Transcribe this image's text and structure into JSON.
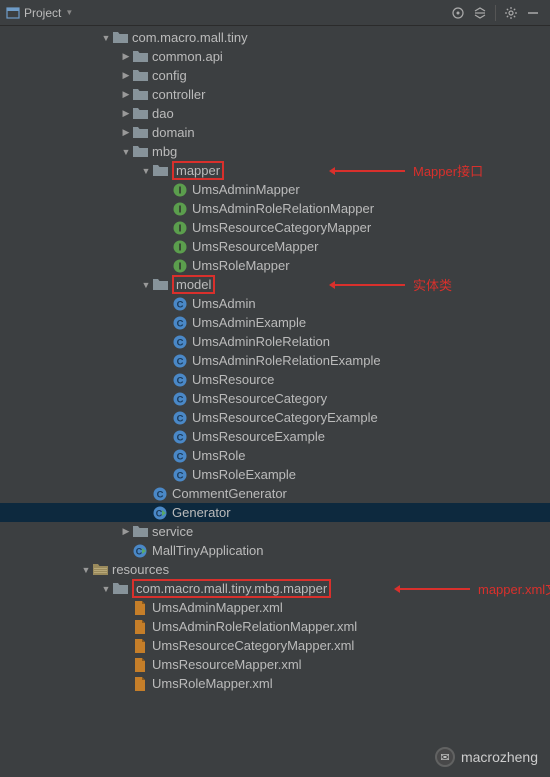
{
  "header": {
    "title": "Project"
  },
  "tree": [
    {
      "depth": 5,
      "arrow": "down",
      "icon": "folder",
      "label": "com.macro.mall.tiny"
    },
    {
      "depth": 6,
      "arrow": "right",
      "icon": "folder",
      "label": "common.api"
    },
    {
      "depth": 6,
      "arrow": "right",
      "icon": "folder",
      "label": "config"
    },
    {
      "depth": 6,
      "arrow": "right",
      "icon": "folder",
      "label": "controller"
    },
    {
      "depth": 6,
      "arrow": "right",
      "icon": "folder",
      "label": "dao"
    },
    {
      "depth": 6,
      "arrow": "right",
      "icon": "folder",
      "label": "domain"
    },
    {
      "depth": 6,
      "arrow": "down",
      "icon": "folder",
      "label": "mbg"
    },
    {
      "depth": 7,
      "arrow": "down",
      "icon": "folder",
      "label": "mapper",
      "boxed": true,
      "anno": "Mapper接口",
      "annoX": 335
    },
    {
      "depth": 8,
      "arrow": "",
      "icon": "interface",
      "label": "UmsAdminMapper"
    },
    {
      "depth": 8,
      "arrow": "",
      "icon": "interface",
      "label": "UmsAdminRoleRelationMapper"
    },
    {
      "depth": 8,
      "arrow": "",
      "icon": "interface",
      "label": "UmsResourceCategoryMapper"
    },
    {
      "depth": 8,
      "arrow": "",
      "icon": "interface",
      "label": "UmsResourceMapper"
    },
    {
      "depth": 8,
      "arrow": "",
      "icon": "interface",
      "label": "UmsRoleMapper"
    },
    {
      "depth": 7,
      "arrow": "down",
      "icon": "folder",
      "label": "model",
      "boxed": true,
      "anno": "实体类",
      "annoX": 335
    },
    {
      "depth": 8,
      "arrow": "",
      "icon": "class",
      "label": "UmsAdmin"
    },
    {
      "depth": 8,
      "arrow": "",
      "icon": "class",
      "label": "UmsAdminExample"
    },
    {
      "depth": 8,
      "arrow": "",
      "icon": "class",
      "label": "UmsAdminRoleRelation"
    },
    {
      "depth": 8,
      "arrow": "",
      "icon": "class",
      "label": "UmsAdminRoleRelationExample"
    },
    {
      "depth": 8,
      "arrow": "",
      "icon": "class",
      "label": "UmsResource"
    },
    {
      "depth": 8,
      "arrow": "",
      "icon": "class",
      "label": "UmsResourceCategory"
    },
    {
      "depth": 8,
      "arrow": "",
      "icon": "class",
      "label": "UmsResourceCategoryExample"
    },
    {
      "depth": 8,
      "arrow": "",
      "icon": "class",
      "label": "UmsResourceExample"
    },
    {
      "depth": 8,
      "arrow": "",
      "icon": "class",
      "label": "UmsRole"
    },
    {
      "depth": 8,
      "arrow": "",
      "icon": "class",
      "label": "UmsRoleExample"
    },
    {
      "depth": 7,
      "arrow": "",
      "icon": "class",
      "label": "CommentGenerator"
    },
    {
      "depth": 7,
      "arrow": "",
      "icon": "runclass",
      "label": "Generator",
      "selected": true
    },
    {
      "depth": 6,
      "arrow": "right",
      "icon": "folder",
      "label": "service"
    },
    {
      "depth": 6,
      "arrow": "",
      "icon": "runclass",
      "label": "MallTinyApplication"
    },
    {
      "depth": 4,
      "arrow": "down",
      "icon": "resfolder",
      "label": "resources"
    },
    {
      "depth": 5,
      "arrow": "down",
      "icon": "folder",
      "label": "com.macro.mall.tiny.mbg.mapper",
      "boxed": true,
      "anno": "mapper.xml文件",
      "annoX": 400
    },
    {
      "depth": 6,
      "arrow": "",
      "icon": "xml",
      "label": "UmsAdminMapper.xml"
    },
    {
      "depth": 6,
      "arrow": "",
      "icon": "xml",
      "label": "UmsAdminRoleRelationMapper.xml"
    },
    {
      "depth": 6,
      "arrow": "",
      "icon": "xml",
      "label": "UmsResourceCategoryMapper.xml"
    },
    {
      "depth": 6,
      "arrow": "",
      "icon": "xml",
      "label": "UmsResourceMapper.xml"
    },
    {
      "depth": 6,
      "arrow": "",
      "icon": "xml",
      "label": "UmsRoleMapper.xml"
    }
  ],
  "watermark": "macrozheng"
}
